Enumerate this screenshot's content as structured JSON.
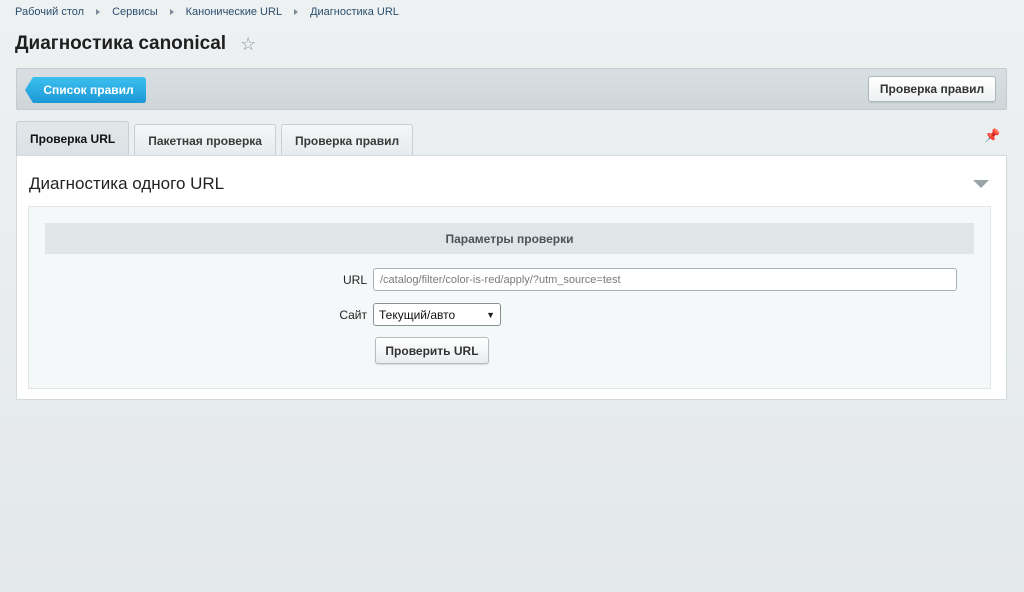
{
  "breadcrumb": [
    "Рабочий стол",
    "Сервисы",
    "Канонические URL",
    "Диагностика URL"
  ],
  "page": {
    "title": "Диагностика canonical"
  },
  "toolbar": {
    "list_button": "Список правил",
    "check_rules_button": "Проверка правил"
  },
  "tabs": [
    {
      "label": "Проверка URL",
      "active": true
    },
    {
      "label": "Пакетная проверка",
      "active": false
    },
    {
      "label": "Проверка правил",
      "active": false
    }
  ],
  "panel": {
    "title": "Диагностика одного URL",
    "section_title": "Параметры проверки",
    "url_label": "URL",
    "url_value": "/catalog/filter/color-is-red/apply/?utm_source=test",
    "site_label": "Сайт",
    "site_value": "Текущий/авто",
    "submit_label": "Проверить URL"
  },
  "icons": {
    "star": "star-icon",
    "pin": "pin-icon",
    "collapse": "chevron-down-icon"
  },
  "colors": {
    "primary_button": "#1c98d6",
    "background": "#e8ecee"
  }
}
